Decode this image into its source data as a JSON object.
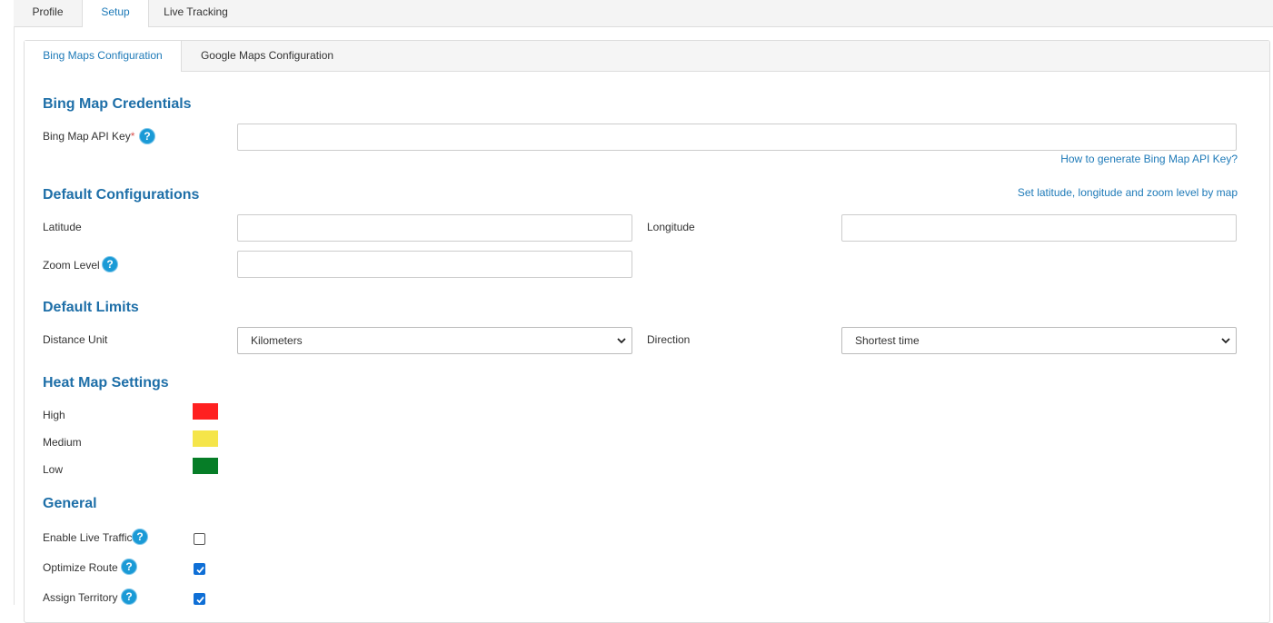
{
  "top_tabs": [
    {
      "label": "Profile"
    },
    {
      "label": "Setup"
    },
    {
      "label": "Live Tracking"
    }
  ],
  "sub_tabs": [
    {
      "label": "Bing Maps Configuration"
    },
    {
      "label": "Google Maps Configuration"
    }
  ],
  "credentials": {
    "title": "Bing Map Credentials",
    "api_key_label": "Bing Map API Key",
    "required_mark": "*",
    "api_key_value": "",
    "help_link": "How to generate Bing Map API Key?"
  },
  "defaults": {
    "title": "Default Configurations",
    "map_link": "Set latitude, longitude and zoom level by map",
    "latitude_label": "Latitude",
    "latitude_value": "",
    "longitude_label": "Longitude",
    "longitude_value": "",
    "zoom_label": "Zoom Level",
    "zoom_value": ""
  },
  "limits": {
    "title": "Default Limits",
    "distance_label": "Distance Unit",
    "distance_value": "Kilometers",
    "direction_label": "Direction",
    "direction_value": "Shortest time"
  },
  "heatmap": {
    "title": "Heat Map Settings",
    "levels": [
      {
        "label": "High",
        "color": "#ff2020"
      },
      {
        "label": "Medium",
        "color": "#f5e54a"
      },
      {
        "label": "Low",
        "color": "#067d27"
      }
    ]
  },
  "general": {
    "title": "General",
    "options": [
      {
        "label": "Enable Live Traffic",
        "checked": false
      },
      {
        "label": "Optimize Route",
        "checked": true
      },
      {
        "label": "Assign Territory",
        "checked": true
      }
    ]
  },
  "help_glyph": "?"
}
